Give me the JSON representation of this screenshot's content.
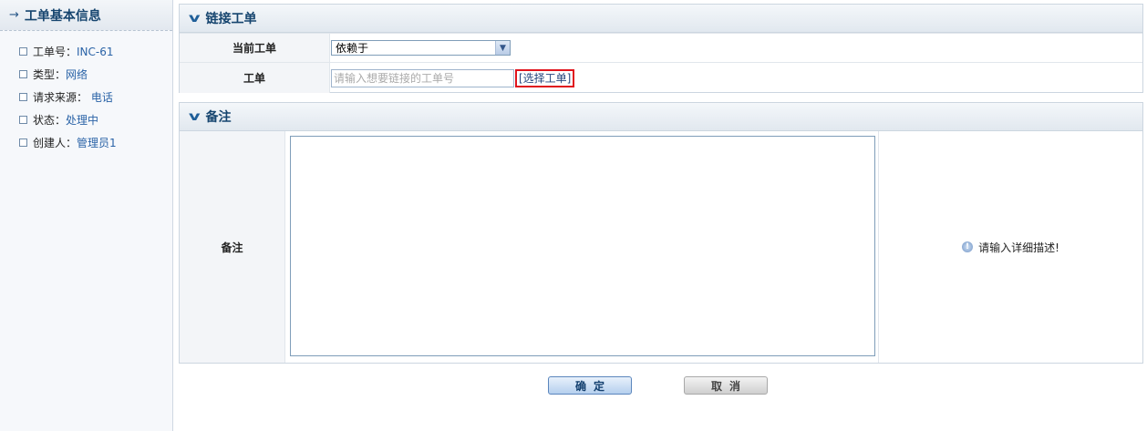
{
  "sidebar": {
    "title": "工单基本信息",
    "items": [
      {
        "label": "工单号：",
        "value": "INC-61"
      },
      {
        "label": "类型：",
        "value": "网络"
      },
      {
        "label": "请求来源：",
        "value": " 电话"
      },
      {
        "label": "状态：",
        "value": "处理中"
      },
      {
        "label": "创建人：",
        "value": "管理员1"
      }
    ]
  },
  "link_section": {
    "title": "链接工单",
    "current_label": "当前工单",
    "current_select_value": "依赖于",
    "ticket_label": "工单",
    "ticket_placeholder": "请输入想要链接的工单号",
    "choose_link": "[选择工单]"
  },
  "note_section": {
    "title": "备注",
    "note_label": "备注",
    "hint": "请输入详细描述!"
  },
  "buttons": {
    "confirm": "确定",
    "cancel": "取消"
  },
  "colors": {
    "accent": "#16456f",
    "link": "#2a63a7",
    "highlight_border": "#e0141d"
  }
}
